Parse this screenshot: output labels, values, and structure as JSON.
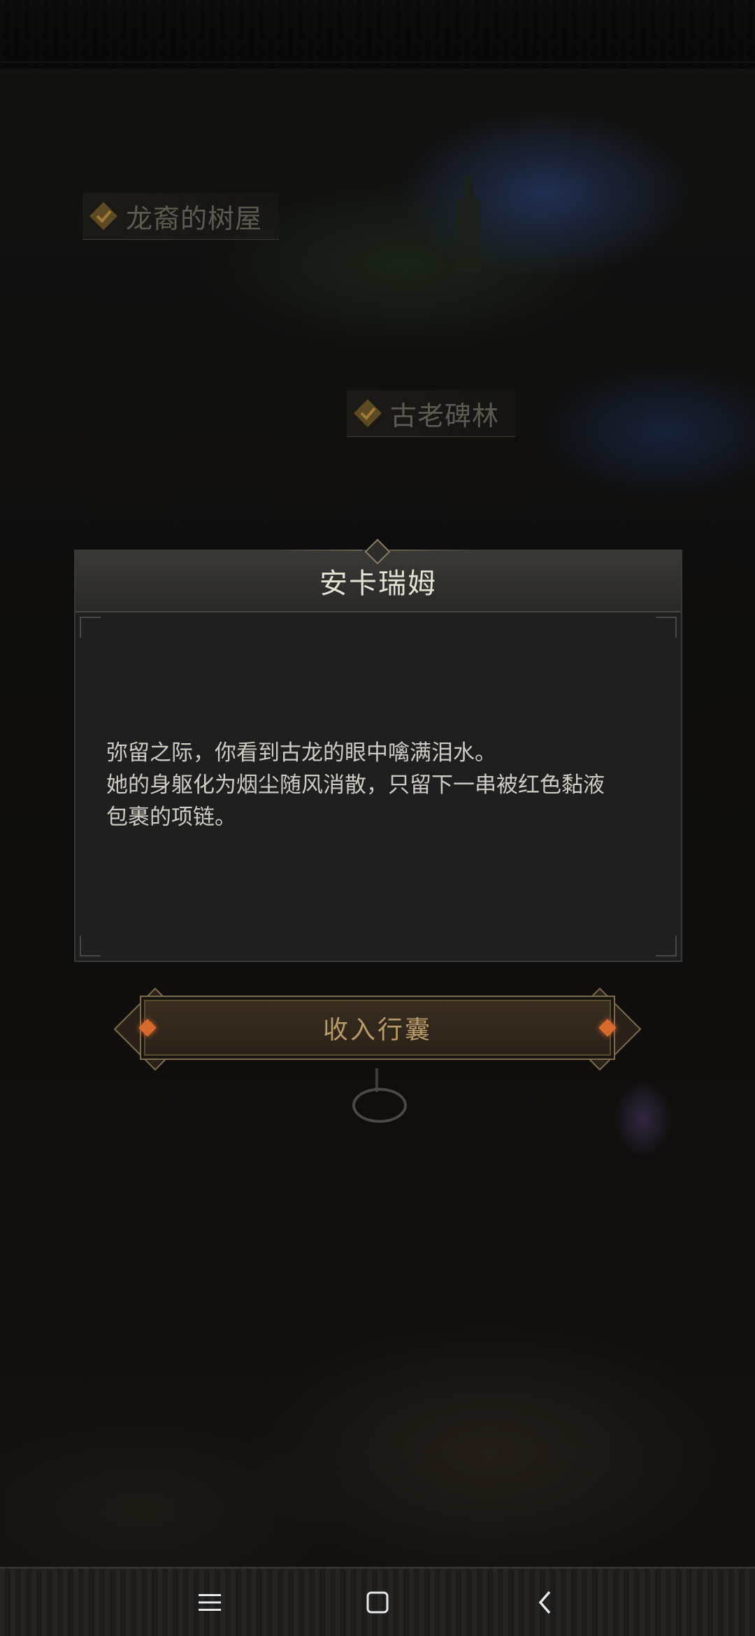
{
  "map": {
    "labels": [
      {
        "text": "龙裔的树屋",
        "checked": true
      },
      {
        "text": "古老碑林",
        "checked": true
      }
    ]
  },
  "dialog": {
    "title": "安卡瑞姆",
    "body_lines": [
      "弥留之际，你看到古龙的眼中噙满泪水。",
      "她的身躯化为烟尘随风消散，只留下一串被红色黏液",
      "包裹的项链。"
    ]
  },
  "stow_button": {
    "label": "收入行囊",
    "accent_color": "#d86a2d",
    "text_color": "#b89a6a"
  },
  "system_nav": {
    "menu_icon": "menu-icon",
    "home_icon": "home-square-icon",
    "back_icon": "back-chevron-icon"
  }
}
